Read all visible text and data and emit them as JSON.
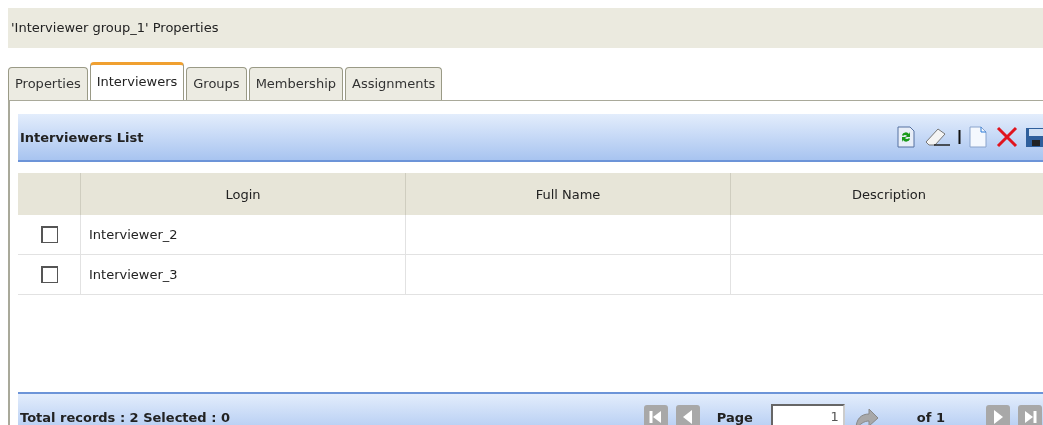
{
  "window": {
    "title": "'Interviewer group_1' Properties"
  },
  "tabs": [
    {
      "label": "Properties",
      "selected": false
    },
    {
      "label": "Interviewers",
      "selected": true
    },
    {
      "label": "Groups",
      "selected": false
    },
    {
      "label": "Membership",
      "selected": false
    },
    {
      "label": "Assignments",
      "selected": false
    }
  ],
  "panel": {
    "title": "Interviewers List"
  },
  "table": {
    "columns": [
      "Login",
      "Full Name",
      "Description"
    ],
    "rows": [
      {
        "checked": false,
        "cells": [
          "Interviewer_2",
          "",
          ""
        ]
      },
      {
        "checked": false,
        "cells": [
          "Interviewer_3",
          "",
          ""
        ]
      }
    ]
  },
  "status_bar": {
    "summary": "Total records : 2 Selected : 0",
    "page_label": "Page",
    "page_value": "1",
    "page_total": "of 1"
  }
}
